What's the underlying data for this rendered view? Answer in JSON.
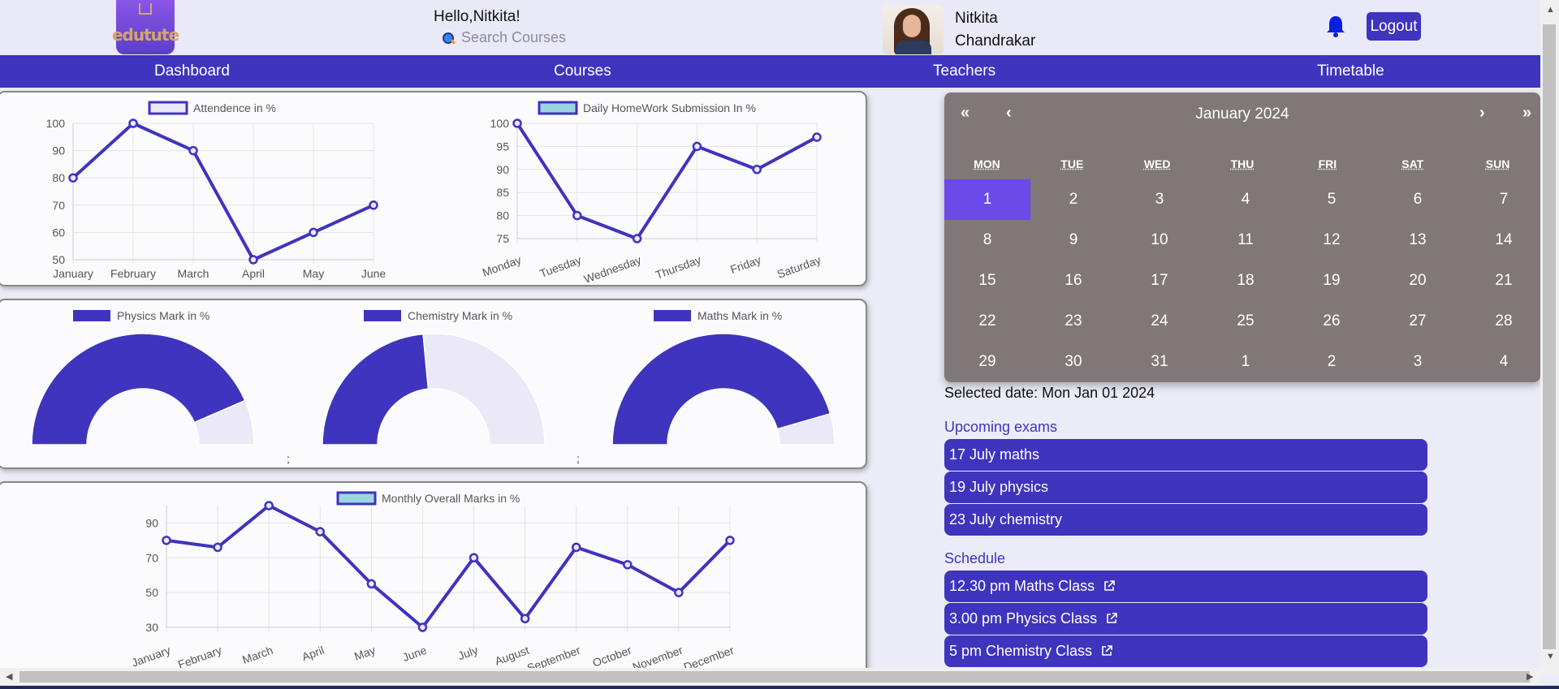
{
  "header": {
    "logo_text": "edutute",
    "greeting": "Hello,Nitkita!",
    "search_placeholder": "Search Courses",
    "user_first": "Nitkita",
    "user_last": "Chandrakar",
    "logout_label": "Logout"
  },
  "nav": [
    "Dashboard",
    "Courses",
    "Teachers",
    "Timetable"
  ],
  "colors": {
    "accent": "#3f34bd",
    "calendar_bg": "#807878",
    "selected_day": "#6a4ae8",
    "donut_empty": "#ebe8f7"
  },
  "chart_data": [
    {
      "type": "line",
      "legend": "Attendence in %",
      "categories": [
        "January",
        "February",
        "March",
        "April",
        "May",
        "June"
      ],
      "values": [
        80,
        100,
        90,
        50,
        60,
        70
      ],
      "yticks": [
        50,
        60,
        70,
        80,
        90,
        100
      ],
      "ylim": [
        50,
        100
      ]
    },
    {
      "type": "line",
      "legend": "Daily HomeWork Submission In %",
      "categories": [
        "Monday",
        "Tuesday",
        "Wednesday",
        "Thursday",
        "Friday",
        "Saturday"
      ],
      "values": [
        100,
        80,
        75,
        95,
        90,
        97
      ],
      "yticks": [
        75,
        80,
        85,
        90,
        95,
        100
      ],
      "ylim": [
        75,
        100
      ]
    },
    {
      "type": "pie",
      "legend": "Physics Mark in %",
      "value": 87
    },
    {
      "type": "pie",
      "legend": "Chemistry Mark in %",
      "value": 47
    },
    {
      "type": "pie",
      "legend": "Maths Mark in %",
      "value": 91
    },
    {
      "type": "line",
      "legend": "Monthly Overall Marks in %",
      "categories": [
        "January",
        "February",
        "March",
        "April",
        "May",
        "June",
        "July",
        "August",
        "September",
        "October",
        "November",
        "December"
      ],
      "values": [
        80,
        76,
        100,
        85,
        55,
        30,
        70,
        35,
        76,
        66,
        50,
        80
      ],
      "yticks": [
        30,
        50,
        70,
        90
      ],
      "ylim": [
        30,
        100
      ]
    }
  ],
  "donut_separators": [
    ";",
    ";"
  ],
  "calendar": {
    "nav_first": "«",
    "nav_prev": "‹",
    "nav_next": "›",
    "nav_last": "»",
    "title": "January 2024",
    "weekdays": [
      "MON",
      "TUE",
      "WED",
      "THU",
      "FRI",
      "SAT",
      "SUN"
    ],
    "days": [
      "1",
      "2",
      "3",
      "4",
      "5",
      "6",
      "7",
      "8",
      "9",
      "10",
      "11",
      "12",
      "13",
      "14",
      "15",
      "16",
      "17",
      "18",
      "19",
      "20",
      "21",
      "22",
      "23",
      "24",
      "25",
      "26",
      "27",
      "28",
      "29",
      "30",
      "31",
      "1",
      "2",
      "3",
      "4"
    ],
    "selected_index": 0
  },
  "selected_date": "Selected date: Mon Jan 01 2024",
  "upcoming_title": "Upcoming exams",
  "exams": [
    "17 July maths",
    "19 July physics",
    "23 July chemistry"
  ],
  "schedule_title": "Schedule",
  "schedule": [
    "12.30 pm Maths Class",
    "3.00 pm Physics Class",
    "5 pm Chemistry Class"
  ]
}
